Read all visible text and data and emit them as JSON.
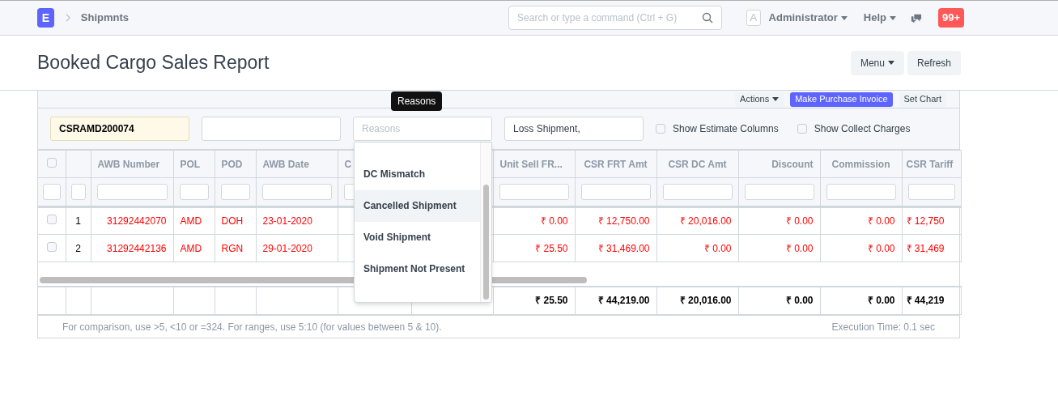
{
  "navbar": {
    "logo": "E",
    "breadcrumb": "Shipmnts",
    "search": {
      "placeholder": "Search or type a command (Ctrl + G)"
    },
    "avatar": "A",
    "user": "Administrator",
    "help": "Help",
    "notifications": "99+"
  },
  "page": {
    "title": "Booked Cargo Sales Report",
    "buttons": [
      {
        "label": "Menu",
        "dropdown": true
      },
      {
        "label": "Refresh",
        "dropdown": false
      }
    ]
  },
  "toolbar": [
    {
      "label": "Actions",
      "kind": "dropdown"
    },
    {
      "label": "Make Purchase Invoice",
      "kind": "primary"
    },
    {
      "label": "Set Chart",
      "kind": "plain"
    }
  ],
  "filters": [
    {
      "kind": "input",
      "value": "CSRAMD200074",
      "highlighted": true
    },
    {
      "kind": "input",
      "highlighted": false
    },
    {
      "kind": "input",
      "placeholder": "Reasons",
      "highlighted": false,
      "tooltip": "Reasons"
    },
    {
      "kind": "input",
      "value": "Loss Shipment,",
      "highlighted": false
    },
    {
      "kind": "checkbox",
      "label": "Show Estimate Columns",
      "checked": false
    },
    {
      "kind": "checkbox",
      "label": "Show Collect Charges",
      "checked": false
    }
  ],
  "reasons_dropdown": {
    "options": [
      {
        "label": "DC Mismatch",
        "selected": false
      },
      {
        "label": "Cancelled Shipment",
        "selected": true
      },
      {
        "label": "Void Shipment",
        "selected": false
      },
      {
        "label": "Shipment Not Present",
        "selected": false
      }
    ]
  },
  "table": {
    "select_all": {
      "checked": false
    },
    "columns": [
      "AWB Number",
      "POL",
      "POD",
      "AWB Date",
      "C"
    ],
    "amount_columns": [
      "Unit Sell FR...",
      "CSR FRT Amt",
      "CSR DC Amt",
      "Discount",
      "Commission",
      "CSR Tariff"
    ],
    "rows": [
      {
        "index": "1",
        "checked": false,
        "cells": [
          "31292442070",
          "AMD",
          "DOH",
          "23-01-2020"
        ],
        "amounts": [
          "₹ 0.00",
          "₹ 12,750.00",
          "₹ 20,016.00",
          "₹ 0.00",
          "₹ 0.00",
          "₹ 12,750"
        ]
      },
      {
        "index": "2",
        "checked": false,
        "cells": [
          "31292442136",
          "AMD",
          "RGN",
          "29-01-2020"
        ],
        "amounts": [
          "₹ 25.50",
          "₹ 31,469.00",
          "₹ 0.00",
          "₹ 0.00",
          "₹ 0.00",
          "₹ 31,469"
        ]
      }
    ],
    "totals": [
      "₹ 25.50",
      "₹ 44,219.00",
      "₹ 20,016.00",
      "₹ 0.00",
      "₹ 0.00",
      "₹ 44,219"
    ]
  },
  "footer": {
    "hint": "For comparison, use >5, <10 or =324. For ranges, use 5:10 (for values between 5 & 10).",
    "execution_time": "Execution Time: 0.1 sec"
  }
}
